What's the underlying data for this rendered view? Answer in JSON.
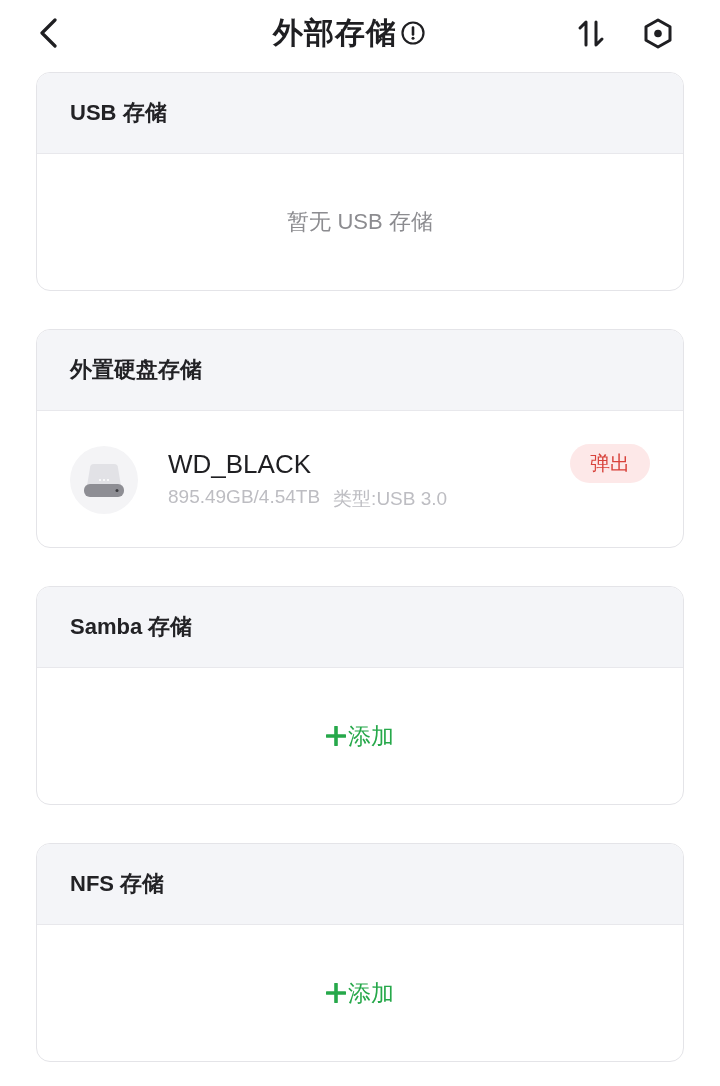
{
  "header": {
    "title": "外部存储"
  },
  "sections": [
    {
      "title": "USB 存储",
      "kind": "empty",
      "message": "暂无 USB 存储"
    },
    {
      "title": "外置硬盘存储",
      "kind": "devices",
      "devices": [
        {
          "name": "WD_BLACK",
          "capacity": "895.49GB/4.54TB",
          "type": "类型:USB 3.0",
          "action": "弹出"
        }
      ]
    },
    {
      "title": "Samba 存储",
      "kind": "add",
      "action": "添加"
    },
    {
      "title": "NFS 存储",
      "kind": "add",
      "action": "添加"
    }
  ]
}
